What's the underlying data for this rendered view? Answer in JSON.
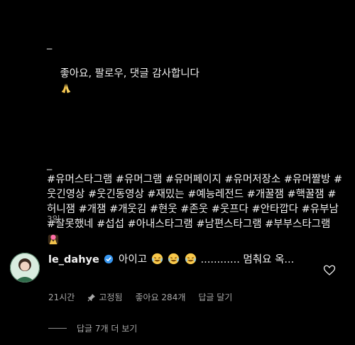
{
  "caption": {
    "lead_dash": "_",
    "thanks": "좋아요, 팔로우, 댓글 감사합니다",
    "hashtag_dash": "_",
    "hashtags": "#유머스타그램 #유머그램 #유머페이지 #유머저장소 #유머짤방 #웃긴영상 #웃긴동영상 #재밌는 #예능레전드 #개꿀잼 #핵꿀잼 #허니잼 #개잼 #개웃김 #현웃 #존웃 #웃프다 #안타깝다 #유부남 #잘못했네 #섭섭 #아내스타그램 #남편스타그램 #부부스타그램",
    "age": "3일"
  },
  "comment": {
    "username": "le_dahye",
    "text_before": "아이고",
    "text_after": "............ 멈춰요 옥...",
    "time": "21시간",
    "pinned": "고정됨",
    "likes": "좋아요 284개",
    "reply": "답글 달기",
    "view_replies": "답글 7개 더 보기"
  },
  "colors": {
    "background": "#000000",
    "text": "#f2f2f2",
    "muted": "#a8a8a8",
    "verified": "#3897f0"
  },
  "icons": [
    "folded-hands-emoji",
    "heart-in-hands-emoji",
    "verified-badge-icon",
    "laughing-emoji",
    "heart-icon",
    "pin-icon"
  ]
}
